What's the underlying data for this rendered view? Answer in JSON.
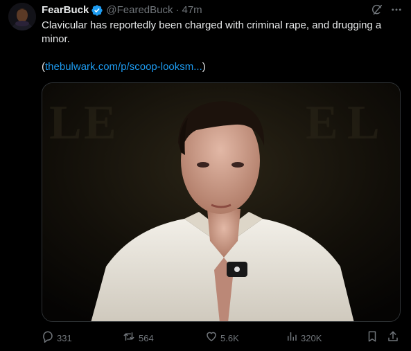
{
  "author": {
    "display_name": "FearBuck",
    "handle": "@FearedBuck",
    "separator": "·",
    "time": "47m"
  },
  "post": {
    "text": "Clavicular has reportedly been charged with criminal rape, and drugging a minor.",
    "link_open": "(",
    "link_text": "thebulwark.com/p/scoop-looksm...",
    "link_close": ")"
  },
  "actions": {
    "replies": "331",
    "reposts": "564",
    "likes": "5.6K",
    "views": "320K"
  },
  "icons": {
    "verified": "verified-badge-icon",
    "grok": "grok-icon",
    "more": "more-icon",
    "reply": "reply-icon",
    "repost": "repost-icon",
    "like": "heart-icon",
    "views": "views-icon",
    "bookmark": "bookmark-icon",
    "share": "share-icon"
  },
  "colors": {
    "background": "#000000",
    "text": "#e7e9ea",
    "muted": "#71767b",
    "link": "#1d9bf0",
    "verified": "#1d9bf0"
  }
}
